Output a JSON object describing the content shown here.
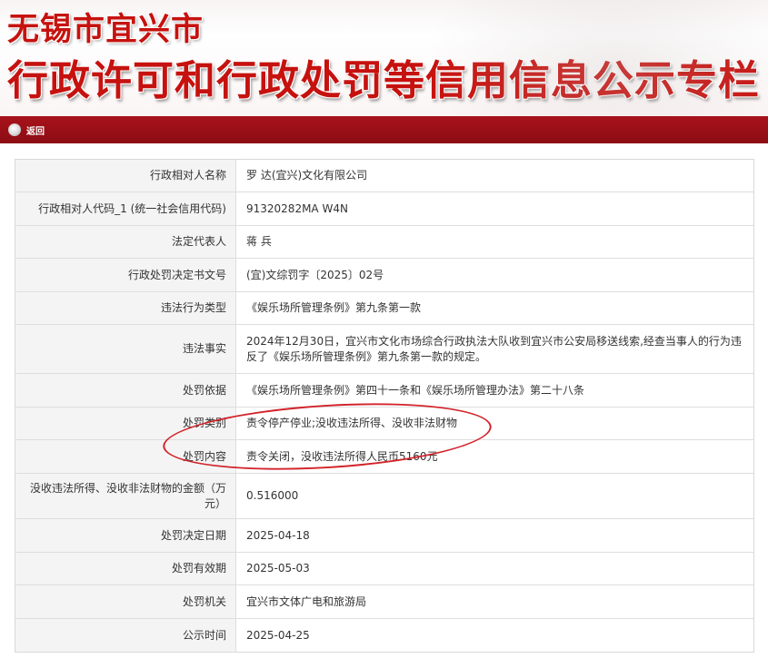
{
  "header": {
    "city": "无锡市宜兴市",
    "column_title": "行政许可和行政处罚等信用信息公示专栏"
  },
  "nav": {
    "back_label": "返回",
    "back_icon": "back-circle-icon"
  },
  "records": [
    {
      "label": "行政相对人名称",
      "value": "罗    达(宜兴)文化有限公司"
    },
    {
      "label": "行政相对人代码_1 (统一社会信用代码)",
      "value": "91320282MA          W4N"
    },
    {
      "label": "法定代表人",
      "value": "蒋    兵"
    },
    {
      "label": "行政处罚决定书文号",
      "value": "(宜)文综罚字〔2025〕02号"
    },
    {
      "label": "违法行为类型",
      "value": "《娱乐场所管理条例》第九条第一款"
    },
    {
      "label": "违法事实",
      "value": "2024年12月30日，宜兴市文化市场综合行政执法大队收到宜兴市公安局移送线索,经查当事人的行为违反了《娱乐场所管理条例》第九条第一款的规定。"
    },
    {
      "label": "处罚依据",
      "value": "《娱乐场所管理条例》第四十一条和《娱乐场所管理办法》第二十八条"
    },
    {
      "label": "处罚类别",
      "value": "责令停产停业;没收违法所得、没收非法财物"
    },
    {
      "label": "处罚内容",
      "value": "责令关闭，没收违法所得人民币5160元"
    },
    {
      "label": "没收违法所得、没收非法财物的金额（万元）",
      "value": "0.516000"
    },
    {
      "label": "处罚决定日期",
      "value": "2025-04-18"
    },
    {
      "label": "处罚有效期",
      "value": "2025-05-03"
    },
    {
      "label": "处罚机关",
      "value": "宜兴市文体广电和旅游局"
    },
    {
      "label": "公示时间",
      "value": "2025-04-25"
    }
  ],
  "colors": {
    "title_red": "#c6120f",
    "nav_red": "#8c0d14",
    "highlight_circle": "#d2232a"
  }
}
